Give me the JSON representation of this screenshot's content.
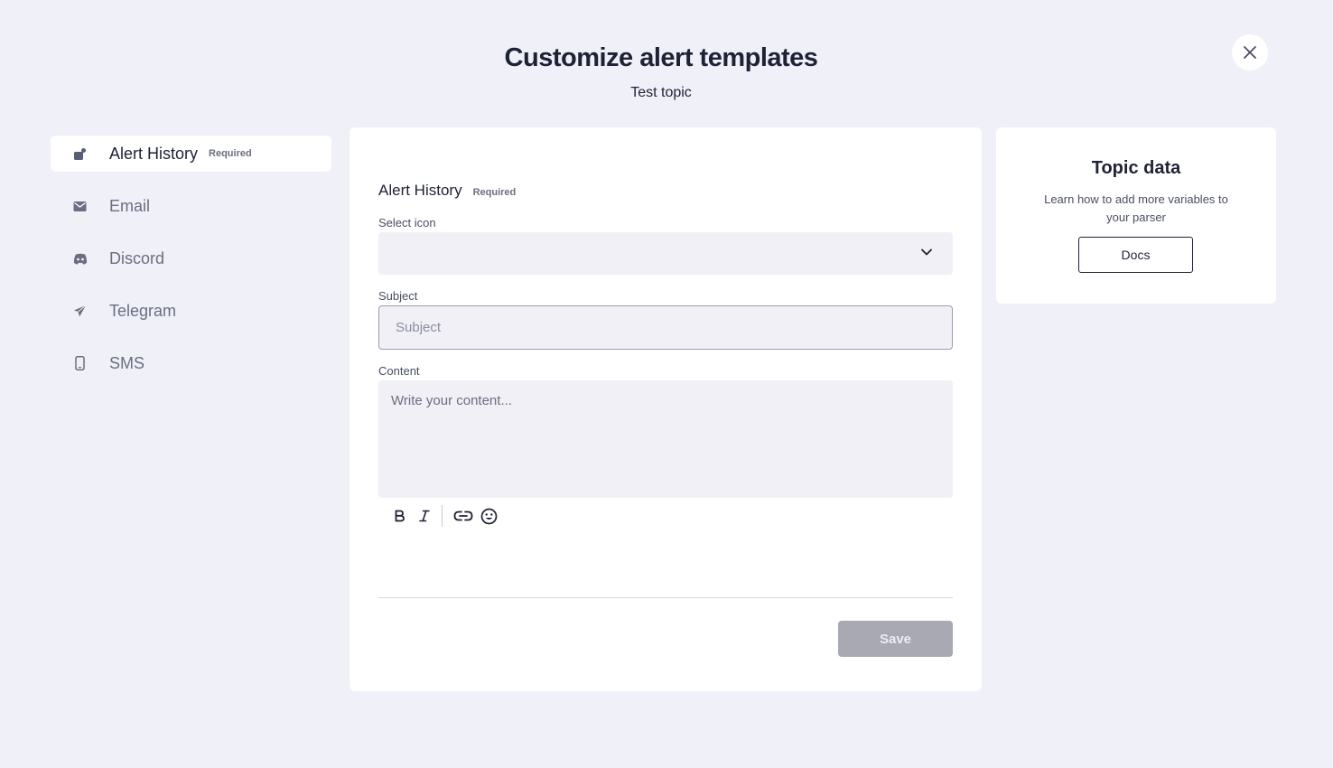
{
  "header": {
    "title": "Customize alert templates",
    "subtitle": "Test topic",
    "close_icon": "close-icon"
  },
  "sidebar": {
    "items": [
      {
        "label": "Alert History",
        "badge": "Required",
        "icon": "bell-history-icon",
        "active": true
      },
      {
        "label": "Email",
        "icon": "envelope-icon"
      },
      {
        "label": "Discord",
        "icon": "discord-icon"
      },
      {
        "label": "Telegram",
        "icon": "telegram-icon"
      },
      {
        "label": "SMS",
        "icon": "phone-icon"
      }
    ]
  },
  "form": {
    "section_title": "Alert History",
    "section_badge": "Required",
    "select_icon_label": "Select icon",
    "select_icon_value": "",
    "subject_label": "Subject",
    "subject_placeholder": "Subject",
    "subject_value": "",
    "content_label": "Content",
    "content_placeholder": "Write your content...",
    "toolbar": [
      "bold-icon",
      "italic-icon",
      "link-icon",
      "emoji-icon"
    ],
    "save_label": "Save"
  },
  "topic": {
    "title": "Topic data",
    "description": "Learn how to add more variables to your parser",
    "docs_label": "Docs"
  },
  "colors": {
    "background": "#f0f0f8",
    "text_primary": "#1e2235",
    "save_disabled": "#a8a9b3"
  }
}
